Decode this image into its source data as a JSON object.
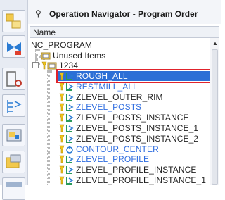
{
  "panel": {
    "title": "Operation Navigator - Program Order",
    "column_header": "Name"
  },
  "tree": {
    "root": "NC_PROGRAM",
    "unused": "Unused Items",
    "group": "1234",
    "operations": [
      "ROUGH_ALL",
      "RESTMILL_ALL",
      "ZLEVEL_OUTER_RIM",
      "ZLEVEL_POSTS",
      "ZLEVEL_POSTS_INSTANCE",
      "ZLEVEL_POSTS_INSTANCE_1",
      "ZLEVEL_POSTS_INSTANCE_2",
      "CONTOUR_CENTER",
      "ZLEVEL_PROFILE",
      "ZLEVEL_PROFILE_INSTANCE",
      "ZLEVEL_PROFILE_INSTANCE_1"
    ]
  },
  "colors": {
    "selection": "#2c6fd6",
    "highlight_box": "#e0232c",
    "link_text": "#2f6de0"
  }
}
